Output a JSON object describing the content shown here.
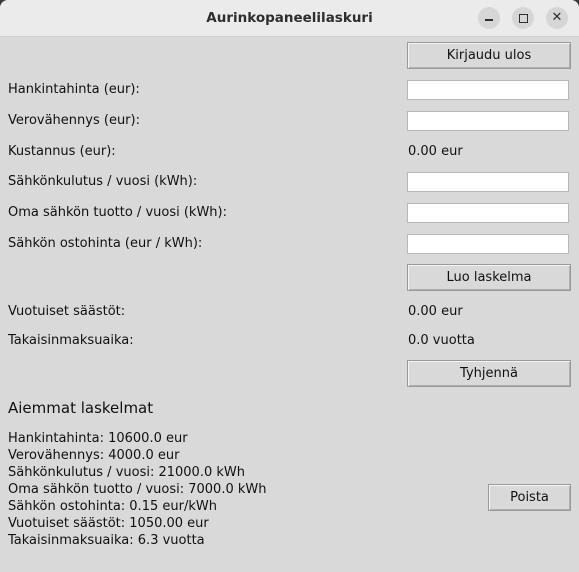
{
  "window": {
    "title": "Aurinkopaneelilaskuri",
    "minimize_icon": "minimize-icon",
    "maximize_icon": "maximize-icon",
    "close_glyph": "✕"
  },
  "header": {
    "logout_label": "Kirjaudu ulos"
  },
  "form": {
    "purchase_price_label": "Hankintahinta (eur):",
    "purchase_price_value": "",
    "tax_deduction_label": "Verovähennys (eur):",
    "tax_deduction_value": "",
    "cost_label": "Kustannus (eur):",
    "cost_value": "0.00 eur",
    "consumption_label": "Sähkönkulutus / vuosi (kWh):",
    "consumption_value": "",
    "own_production_label": "Oma sähkön tuotto / vuosi (kWh):",
    "own_production_value": "",
    "purchase_rate_label": "Sähkön ostohinta (eur / kWh):",
    "purchase_rate_value": "",
    "calculate_label": "Luo laskelma",
    "annual_savings_label": "Vuotuiset säästöt:",
    "annual_savings_value": "0.00 eur",
    "payback_label": "Takaisinmaksuaika:",
    "payback_value": "0.0 vuotta",
    "clear_label": "Tyhjennä"
  },
  "history": {
    "heading": "Aiemmat laskelmat",
    "lines": [
      "Hankintahinta: 10600.0 eur",
      "Verovähennys: 4000.0 eur",
      "Sähkönkulutus / vuosi: 21000.0 kWh",
      "Oma sähkön tuotto / vuosi: 7000.0 kWh",
      "Sähkön ostohinta: 0.15 eur/kWh",
      "Vuotuiset säästöt: 1050.00 eur",
      "Takaisinmaksuaika: 6.3 vuotta"
    ],
    "delete_label": "Poista"
  }
}
